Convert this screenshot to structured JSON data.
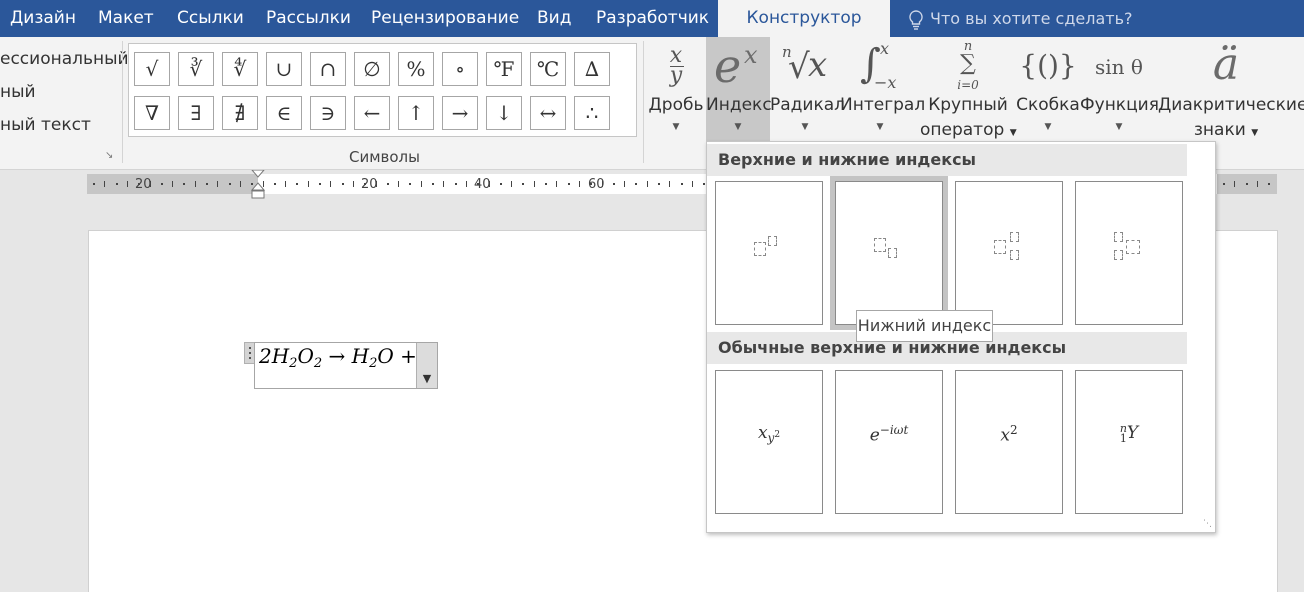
{
  "tabs": [
    {
      "label": "Дизайн"
    },
    {
      "label": "Макет"
    },
    {
      "label": "Ссылки"
    },
    {
      "label": "Рассылки"
    },
    {
      "label": "Рецензирование"
    },
    {
      "label": "Вид"
    },
    {
      "label": "Разработчик"
    },
    {
      "label": "Конструктор",
      "active": true
    }
  ],
  "tell_me": {
    "placeholder": "Что вы хотите сделать?",
    "icon": "lightbulb-icon"
  },
  "styles": {
    "items": [
      "ессиональный",
      "ный",
      "ный текст"
    ]
  },
  "symbols": {
    "group_label": "Символы",
    "row1": [
      "√",
      "∛",
      "∜",
      "∪",
      "∩",
      "∅",
      "%",
      "∘",
      "℉",
      "℃",
      "∆"
    ],
    "row2": [
      "∇",
      "∃",
      "∄",
      "∈",
      "∋",
      "←",
      "↑",
      "→",
      "↓",
      "↔",
      "∴"
    ]
  },
  "structures": [
    {
      "label": "Дробь",
      "icon_top": "x",
      "icon_bottom": "y",
      "icon": "fraction-icon"
    },
    {
      "label": "Индекс",
      "icon_base": "e",
      "icon_sup": "x",
      "icon": "script-icon",
      "selected": true
    },
    {
      "label": "Радикал",
      "icon_index": "n",
      "icon_radicand": "x",
      "icon": "radical-icon"
    },
    {
      "label": "Интеграл",
      "icon_upper": "x",
      "icon_lower": "−x",
      "icon": "integral-icon"
    },
    {
      "label": "Крупный",
      "label2": "оператор",
      "icon_upper": "n",
      "icon_symbol": "∑",
      "icon_lower": "i=0",
      "icon": "large-operator-icon"
    },
    {
      "label": "Скобка",
      "icon_text": "{()}",
      "icon": "bracket-icon"
    },
    {
      "label": "Функция",
      "icon_text": "sin θ",
      "icon": "function-icon"
    },
    {
      "label": "Диакритические",
      "label2": "знаки",
      "icon_text": "ä",
      "icon": "accent-icon"
    }
  ],
  "ruler": {
    "labels": [
      "20",
      "20",
      "40",
      "60"
    ]
  },
  "equation": {
    "parts": [
      "2H",
      "2",
      "O",
      "2",
      " → H",
      "2",
      "O +"
    ]
  },
  "gallery": {
    "section1_title": "Верхние и нижние индексы",
    "section2_title": "Обычные верхние и нижние индексы",
    "templates": [
      "superscript",
      "subscript",
      "sub-superscript",
      "left-sub-superscript"
    ],
    "examples": [
      {
        "base": "x",
        "sub": "y",
        "subsup": "2"
      },
      {
        "base": "e",
        "sup": "−iωt"
      },
      {
        "base": "x",
        "sup": "2"
      },
      {
        "pre_sup": "n",
        "pre_sub": "1",
        "base": "Y"
      }
    ],
    "tooltip": "Нижний индекс"
  }
}
